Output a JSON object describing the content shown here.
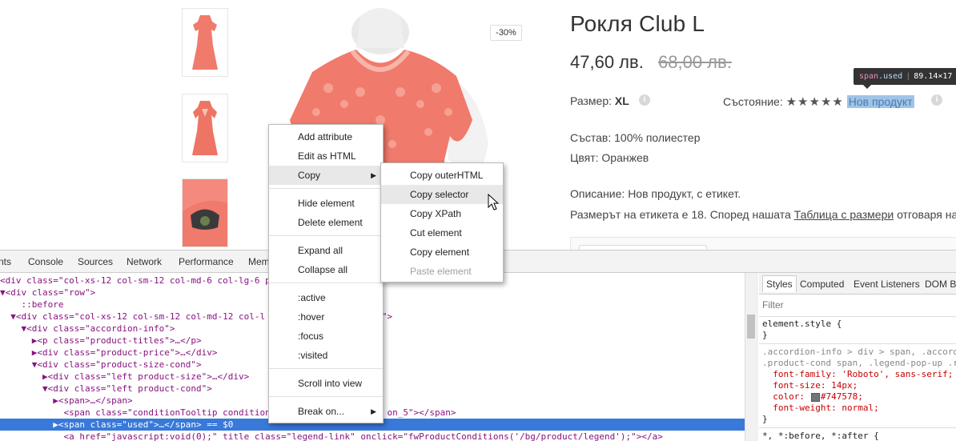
{
  "product": {
    "title": "Рокля Club L",
    "price": "47,60 лв.",
    "old_price": "68,00 лв.",
    "discount": "-30%",
    "size_label": "Размер:",
    "size_value": "XL",
    "condition_label": "Състояние:",
    "stars": "★★★★★",
    "condition_value": "Нов продукт",
    "composition": "Състав: 100% полиестер",
    "color": "Цвят: Оранжев",
    "description": "Описание: Нов продукт, с етикет.",
    "size_note_prefix": "Размерът на етикета е 18. Според нашата ",
    "size_note_link": "Таблица с размери",
    "size_note_suffix": " отговаря на"
  },
  "tooltip": {
    "tag": "span",
    "cls": ".used",
    "dims": "89.14×17"
  },
  "devtools": {
    "tabs": [
      "nts",
      "Console",
      "Sources",
      "Network",
      "Performance",
      "Mem"
    ],
    "style_tabs": [
      "Styles",
      "Computed",
      "Event Listeners",
      "DOM B"
    ],
    "filter_placeholder": "Filter",
    "dom_lines": [
      {
        "t": "<div class=\"col-xs-12 col-sm-12 col-md-6 col-lg-6 p"
      },
      {
        "t": "▼<div class=\"row\">"
      },
      {
        "t": "    ::before"
      },
      {
        "t": "  ▼<div class=\"col-xs-12 col-sm-12 col-md-12 col-l                      \">"
      },
      {
        "t": "    ▼<div class=\"accordion-info\">"
      },
      {
        "t": "      ▶<p class=\"product-titles\">…</p>"
      },
      {
        "t": "      ▶<div class=\"product-price\">…</div>"
      },
      {
        "t": "      ▼<div class=\"product-size-cond\">"
      },
      {
        "t": "        ▶<div class=\"left product-size\">…</div>"
      },
      {
        "t": "        ▼<div class=\"left product-cond\">"
      },
      {
        "t": "          ▶<span>…</span>"
      },
      {
        "t": "            <span class=\"conditionTooltip condition-                     on_5\"></span>"
      },
      {
        "t": "          ▶<span class=\"used\">…</span> == $0"
      },
      {
        "t": "            <a href=\"javascript:void(0);\" title class=\"legend-link\" onclick=\"fwProductConditions('/bg/product/legend');\"></a>"
      }
    ],
    "style_lines": [
      {
        "t": "element.style {"
      },
      {
        "t": "}"
      },
      {
        "t": ".accordion-info > div > span, .accord"
      },
      {
        "t": ".product-cond span, .legend-pop-up .r"
      },
      {
        "t": "  font-family: 'Roboto', sans-serif;"
      },
      {
        "t": "  font-size: 14px;"
      },
      {
        "t": "  color:   #747578;"
      },
      {
        "t": "  font-weight: normal;"
      },
      {
        "t": "}"
      },
      {
        "t": "*, *:before, *:after {"
      }
    ]
  },
  "context_menu": {
    "items": [
      "Add attribute",
      "Edit as HTML",
      "Copy",
      "Hide element",
      "Delete element",
      "Expand all",
      "Collapse all",
      ":active",
      ":hover",
      ":focus",
      ":visited",
      "Scroll into view",
      "Break on..."
    ]
  },
  "copy_submenu": {
    "items": [
      "Copy outerHTML",
      "Copy selector",
      "Copy XPath",
      "Cut element",
      "Copy element",
      "Paste element"
    ]
  },
  "colors": {
    "dress": "#f07a6c",
    "selection": "#3879d9",
    "highlight": "#9fc4e7"
  }
}
